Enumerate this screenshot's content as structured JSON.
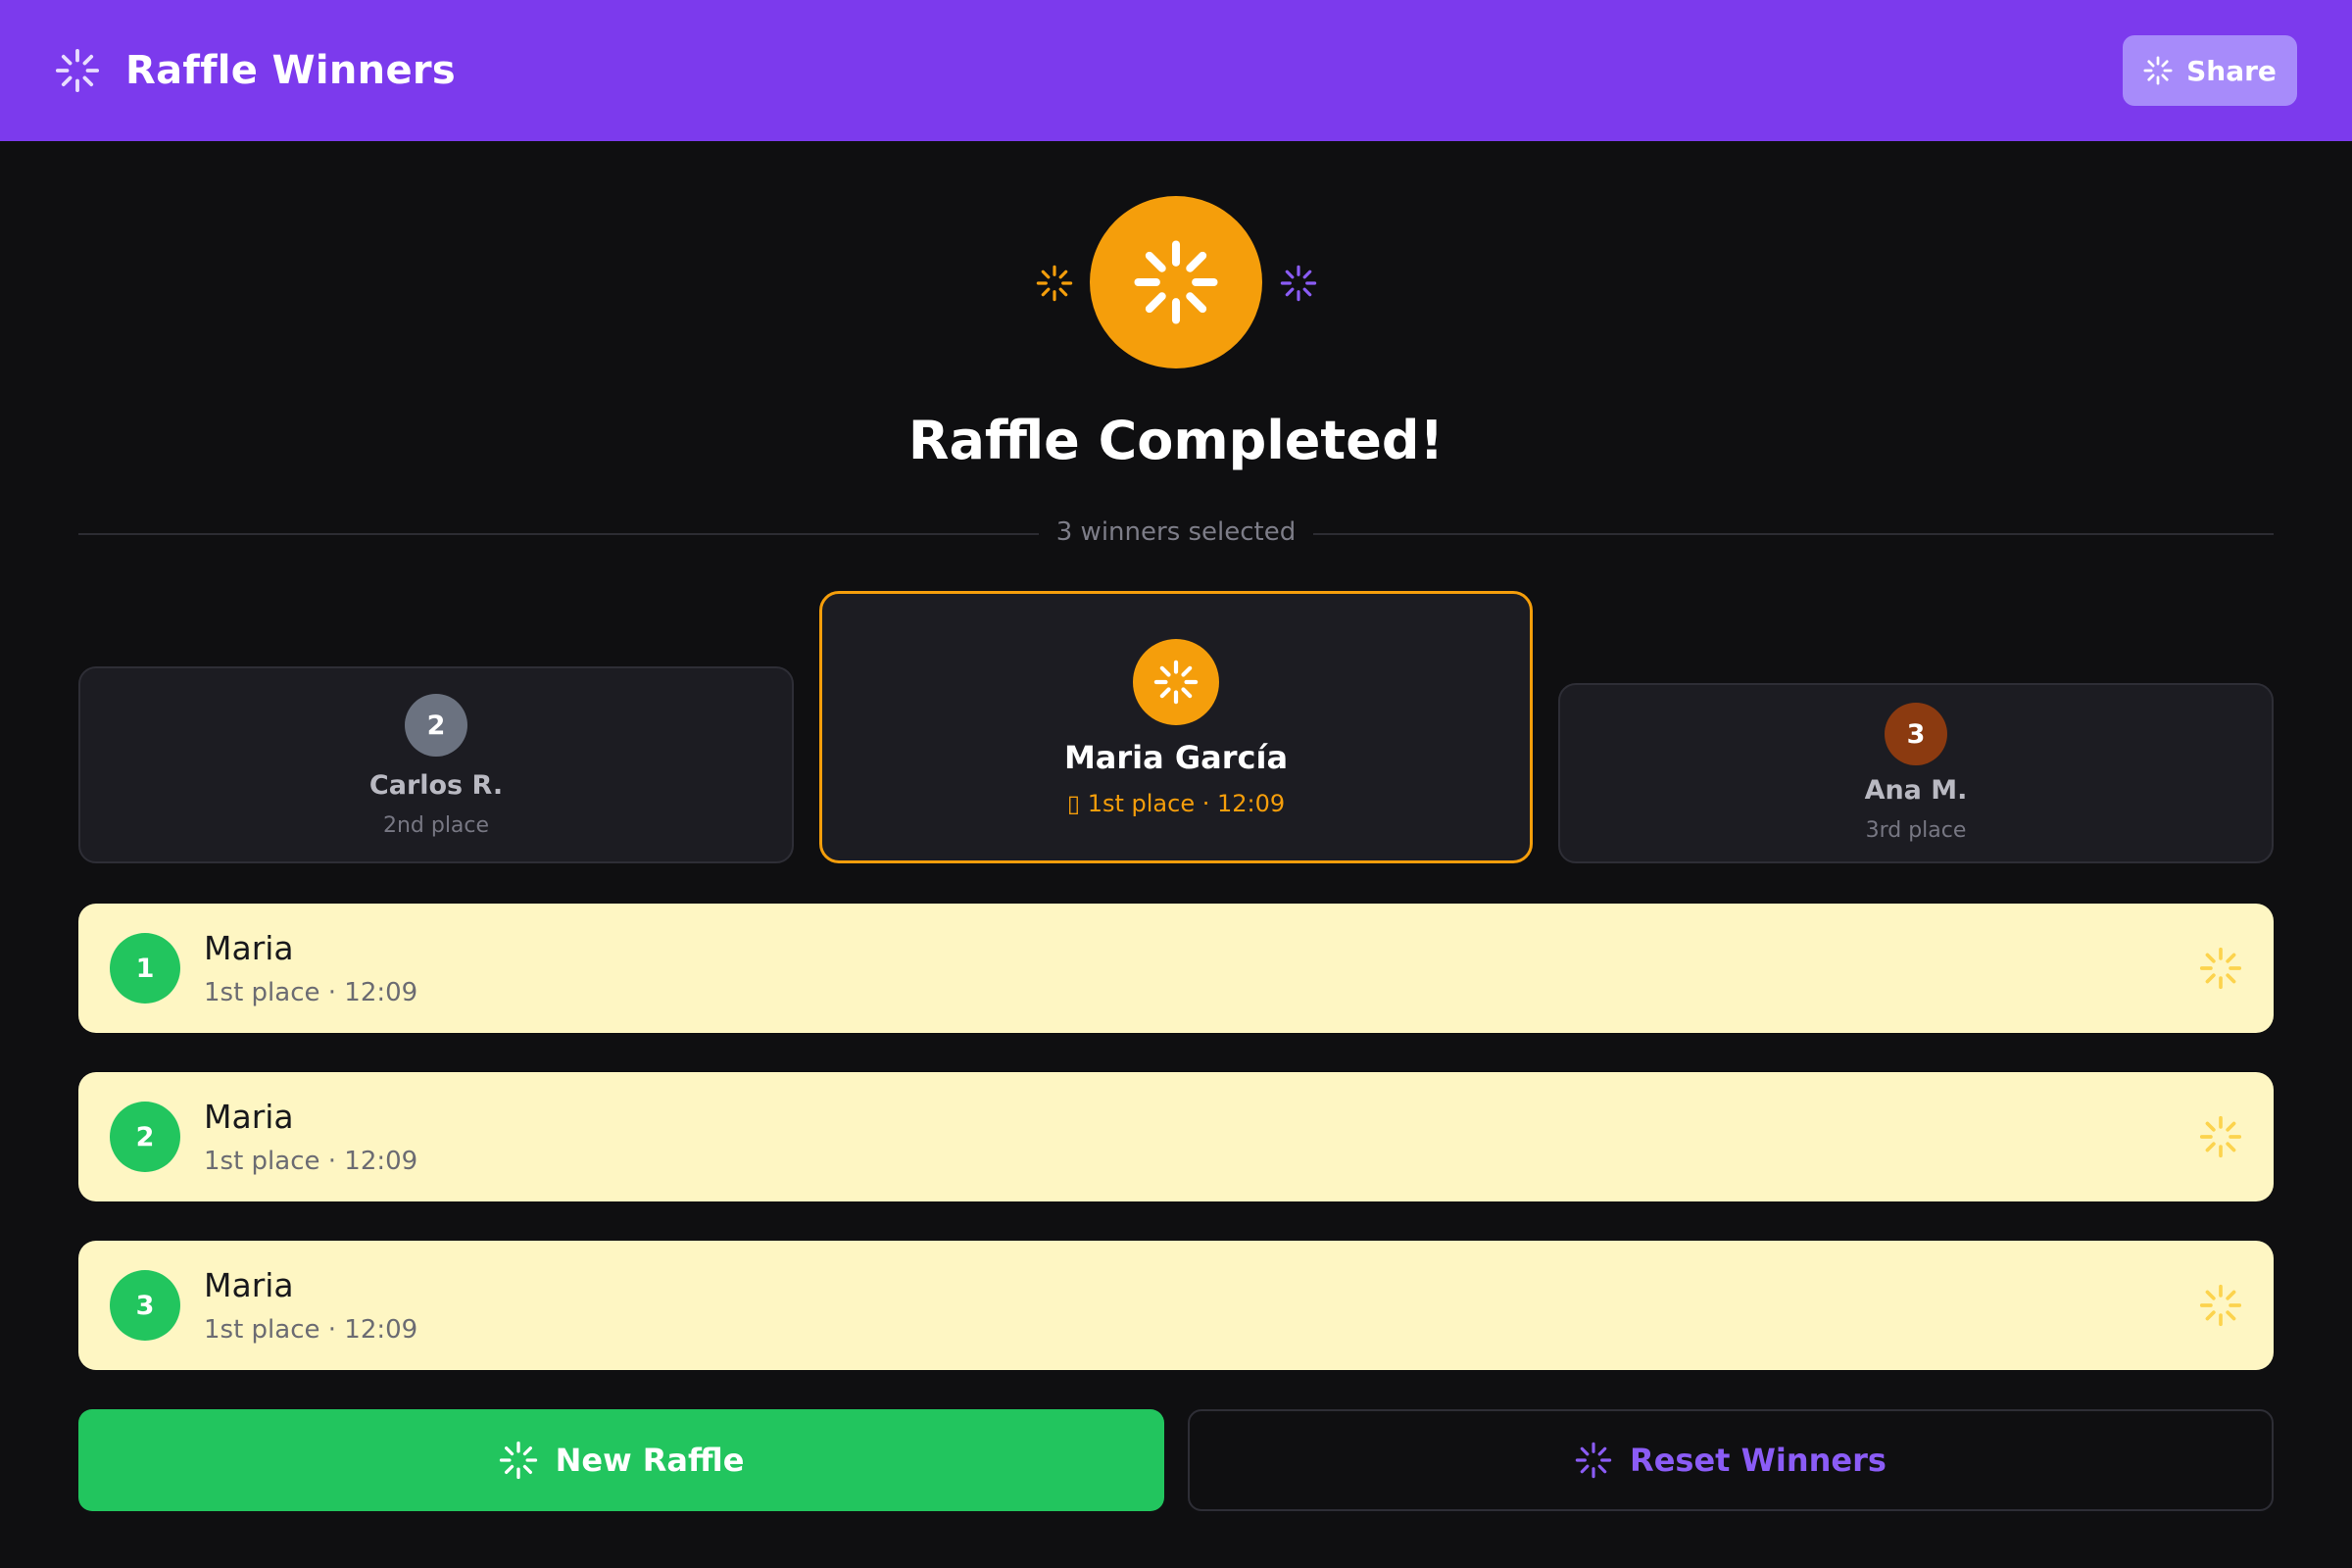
{
  "header": {
    "title": "Raffle Winners",
    "icon": "sparkle-icon",
    "share_label": "Share"
  },
  "hero": {
    "title": "Raffle Completed!",
    "icon": "sparkle-icon"
  },
  "divider": {
    "text": "3 winners selected"
  },
  "podium": {
    "second": {
      "rank": "2",
      "name": "Carlos R.",
      "place": "2nd place"
    },
    "first": {
      "name": "Maria García",
      "place": "▯ 1st place · 12:09"
    },
    "third": {
      "rank": "3",
      "name": "Ana M.",
      "place": "3rd place"
    }
  },
  "winners": [
    {
      "rank": "1",
      "name": "Maria",
      "detail": "1st place · 12:09"
    },
    {
      "rank": "2",
      "name": "Maria",
      "detail": "1st place · 12:09"
    },
    {
      "rank": "3",
      "name": "Maria",
      "detail": "1st place · 12:09"
    }
  ],
  "actions": {
    "new_raffle_label": "New Raffle",
    "reset_winners_label": "Reset Winners"
  },
  "colors": {
    "header_bg": "#7c3aed",
    "accent_gold": "#f59e0b",
    "accent_green": "#22c55e",
    "accent_purple": "#8b5cf6",
    "bronze": "#8b3a10",
    "silver": "#6b7280",
    "row_bg": "#fef6c3",
    "page_bg": "#0f0f11"
  }
}
